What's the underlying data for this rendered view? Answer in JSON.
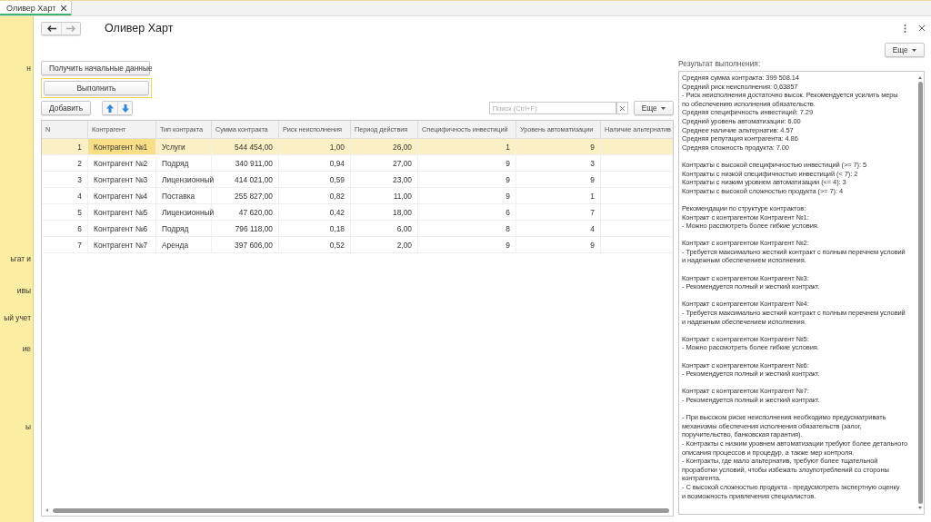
{
  "tabs": [
    {
      "label": "Оливер Харт",
      "selected": true
    }
  ],
  "sidebar": {
    "items": [
      "н",
      "ьгат и",
      "ивы",
      "ый учет",
      "ие",
      "ы"
    ]
  },
  "form": {
    "title": "Оливер Харт",
    "more_button": "Еще"
  },
  "buttons": {
    "get_data": "Получить начальные данные",
    "execute": "Выполнить",
    "add": "Добавить"
  },
  "search": {
    "placeholder": "Поиск (Ctrl+F)",
    "more_button": "Еще"
  },
  "table": {
    "columns": [
      "N",
      "Контрагент",
      "Тип контракта",
      "Сумма контракта",
      "Риск неисполнения",
      "Период действия",
      "Специфичность инвестиций",
      "Уровень автоматизации",
      "Наличие альтернатив"
    ],
    "rows": [
      {
        "cells": [
          "1",
          "Контрагент №1",
          "Услуги",
          "544 454,00",
          "1,00",
          "26,00",
          "1",
          "9",
          ""
        ],
        "selected": true
      },
      {
        "cells": [
          "2",
          "Контрагент №2",
          "Подряд",
          "340 911,00",
          "0,94",
          "27,00",
          "9",
          "3",
          ""
        ],
        "selected": false
      },
      {
        "cells": [
          "3",
          "Контрагент №3",
          "Лицензионный",
          "414 021,00",
          "0,59",
          "23,00",
          "9",
          "9",
          ""
        ],
        "selected": false
      },
      {
        "cells": [
          "4",
          "Контрагент №4",
          "Поставка",
          "255 827,00",
          "0,82",
          "11,00",
          "9",
          "1",
          ""
        ],
        "selected": false
      },
      {
        "cells": [
          "5",
          "Контрагент №5",
          "Лицензионный",
          "47 620,00",
          "0,42",
          "18,00",
          "6",
          "7",
          ""
        ],
        "selected": false
      },
      {
        "cells": [
          "6",
          "Контрагент №6",
          "Подряд",
          "796 118,00",
          "0,18",
          "6,00",
          "8",
          "4",
          ""
        ],
        "selected": false
      },
      {
        "cells": [
          "7",
          "Контрагент №7",
          "Аренда",
          "397 606,00",
          "0,52",
          "2,00",
          "9",
          "9",
          ""
        ],
        "selected": false
      }
    ]
  },
  "result": {
    "label": "Результат выполнения:",
    "paragraphs": [
      [
        "Средняя сумма контракта: 399 508.14",
        "Средний риск неисполнения: 0,63857",
        "- Риск неисполнения достаточно высок. Рекомендуется усилить меры",
        "по обеспечению исполнения обязательств.",
        "Средняя специфичность инвестиций: 7.29",
        "Средний уровень автоматизации: 6.00",
        "Среднее наличие альтернатив: 4.57",
        "Средняя репутация контрагента: 4.86",
        "Средняя сложность продукта: 7.00"
      ],
      [
        "Контракты с высокой специфичностью инвестиций (>= 7): 5",
        "Контракты с низкой специфичностью инвестиций (< 7): 2",
        "Контракты с низким уровнем автоматизации (<= 4): 3",
        "Контракты с высокой сложностью продукта (>= 7): 4"
      ],
      [
        "Рекомендации по структуре контрактов:",
        "Контракт с контрагентом Контрагент №1:",
        "- Можно рассмотреть более гибкие условия."
      ],
      [
        "Контракт с контрагентом Контрагент №2:",
        "- Требуется максимально жесткий контракт с полным перечнем условий",
        "и надежным обеспечением исполнения."
      ],
      [
        "Контракт с контрагентом Контрагент №3:",
        "- Рекомендуется полный и жесткий контракт."
      ],
      [
        "Контракт с контрагентом Контрагент №4:",
        "- Требуется максимально жесткий контракт с полным перечнем условий",
        "и надежным обеспечением исполнения."
      ],
      [
        "Контракт с контрагентом Контрагент №5:",
        "- Можно рассмотреть более гибкие условия."
      ],
      [
        "Контракт с контрагентом Контрагент №6:",
        "- Рекомендуется полный и жесткий контракт."
      ],
      [
        "Контракт с контрагентом Контрагент №7:",
        "- Рекомендуется полный и жесткий контракт."
      ],
      [
        "- При высоком риске неисполнения необходимо предусматривать",
        "механизмы обеспечения исполнения обязательств (залог,",
        "поручительство, банковская гарантия).",
        "- Контракты с низким уровнем автоматизации требуют более детального",
        "описания процессов и процедур, а также мер контроля.",
        "- Контракты, где мало альтернатив, требуют более тщательной",
        "проработки условий, чтобы избежать злоупотреблений со стороны",
        "контрагента.",
        "- С высокой сложностью продукта  - предусмотреть экспертную оценку",
        "и возможность привлечения специалистов."
      ]
    ]
  }
}
